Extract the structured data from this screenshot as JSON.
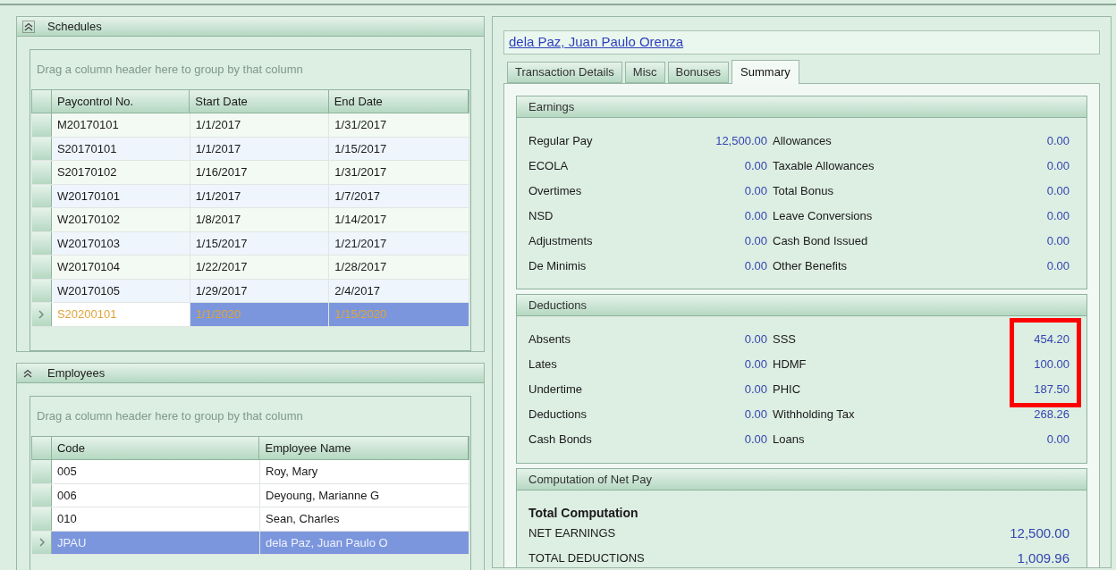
{
  "left": {
    "panels": [
      {
        "title": "Schedules",
        "group_hint": "Drag a column header here to group by that column",
        "columns": [
          "Paycontrol No.",
          "Start Date",
          "End Date"
        ],
        "rows": [
          {
            "cells": [
              "M20170101",
              "1/1/2017",
              "1/31/2017"
            ],
            "selected": false
          },
          {
            "cells": [
              "S20170101",
              "1/1/2017",
              "1/15/2017"
            ],
            "selected": false
          },
          {
            "cells": [
              "S20170102",
              "1/16/2017",
              "1/31/2017"
            ],
            "selected": false
          },
          {
            "cells": [
              "W20170101",
              "1/1/2017",
              "1/7/2017"
            ],
            "selected": false
          },
          {
            "cells": [
              "W20170102",
              "1/8/2017",
              "1/14/2017"
            ],
            "selected": false
          },
          {
            "cells": [
              "W20170103",
              "1/15/2017",
              "1/21/2017"
            ],
            "selected": false
          },
          {
            "cells": [
              "W20170104",
              "1/22/2017",
              "1/28/2017"
            ],
            "selected": false
          },
          {
            "cells": [
              "W20170105",
              "1/29/2017",
              "2/4/2017"
            ],
            "selected": false
          },
          {
            "cells": [
              "S20200101",
              "1/1/2020",
              "1/15/2020"
            ],
            "selected": true
          }
        ]
      },
      {
        "title": "Employees",
        "group_hint": "Drag a column header here to group by that column",
        "columns": [
          "Code",
          "Employee Name"
        ],
        "rows": [
          {
            "cells": [
              "005",
              "Roy, Mary"
            ],
            "selected": false
          },
          {
            "cells": [
              "006",
              "Deyoung, Marianne G"
            ],
            "selected": false
          },
          {
            "cells": [
              "010",
              "Sean, Charles"
            ],
            "selected": false
          },
          {
            "cells": [
              "JPAU",
              "dela Paz, Juan Paulo O"
            ],
            "selected": true
          }
        ]
      }
    ]
  },
  "right": {
    "employee_link": "dela Paz, Juan Paulo Orenza",
    "tabs": [
      {
        "label": "Transaction Details",
        "selected": false
      },
      {
        "label": "Misc",
        "selected": false
      },
      {
        "label": "Bonuses",
        "selected": false
      },
      {
        "label": "Summary",
        "selected": true
      }
    ],
    "earnings": {
      "title": "Earnings",
      "rows": [
        {
          "left_label": "Regular Pay",
          "left_value": "12,500.00",
          "right_label": "Allowances",
          "right_value": "0.00",
          "highlighted": false
        },
        {
          "left_label": "ECOLA",
          "left_value": "0.00",
          "right_label": "Taxable Allowances",
          "right_value": "0.00",
          "highlighted": false
        },
        {
          "left_label": "Overtimes",
          "left_value": "0.00",
          "right_label": "Total Bonus",
          "right_value": "0.00",
          "highlighted": false
        },
        {
          "left_label": "NSD",
          "left_value": "0.00",
          "right_label": "Leave Conversions",
          "right_value": "0.00",
          "highlighted": false
        },
        {
          "left_label": "Adjustments",
          "left_value": "0.00",
          "right_label": "Cash Bond Issued",
          "right_value": "0.00",
          "highlighted": false
        },
        {
          "left_label": "De Minimis",
          "left_value": "0.00",
          "right_label": "Other Benefits",
          "right_value": "0.00",
          "highlighted": false
        }
      ]
    },
    "deductions": {
      "title": "Deductions",
      "rows": [
        {
          "left_label": "Absents",
          "left_value": "0.00",
          "right_label": "SSS",
          "right_value": "454.20",
          "highlighted": true
        },
        {
          "left_label": "Lates",
          "left_value": "0.00",
          "right_label": "HDMF",
          "right_value": "100.00",
          "highlighted": true
        },
        {
          "left_label": "Undertime",
          "left_value": "0.00",
          "right_label": "PHIC",
          "right_value": "187.50",
          "highlighted": true
        },
        {
          "left_label": "Deductions",
          "left_value": "0.00",
          "right_label": "Withholding Tax",
          "right_value": "268.26",
          "highlighted": false
        },
        {
          "left_label": "Cash Bonds",
          "left_value": "0.00",
          "right_label": "Loans",
          "right_value": "0.00",
          "highlighted": false
        }
      ]
    },
    "net_pay": {
      "title": "Computation of Net Pay",
      "heading": "Total Computation",
      "rows": [
        {
          "label": "NET EARNINGS",
          "value": "12,500.00"
        },
        {
          "label": "TOTAL DEDUCTIONS",
          "value": "1,009.96"
        }
      ]
    }
  }
}
